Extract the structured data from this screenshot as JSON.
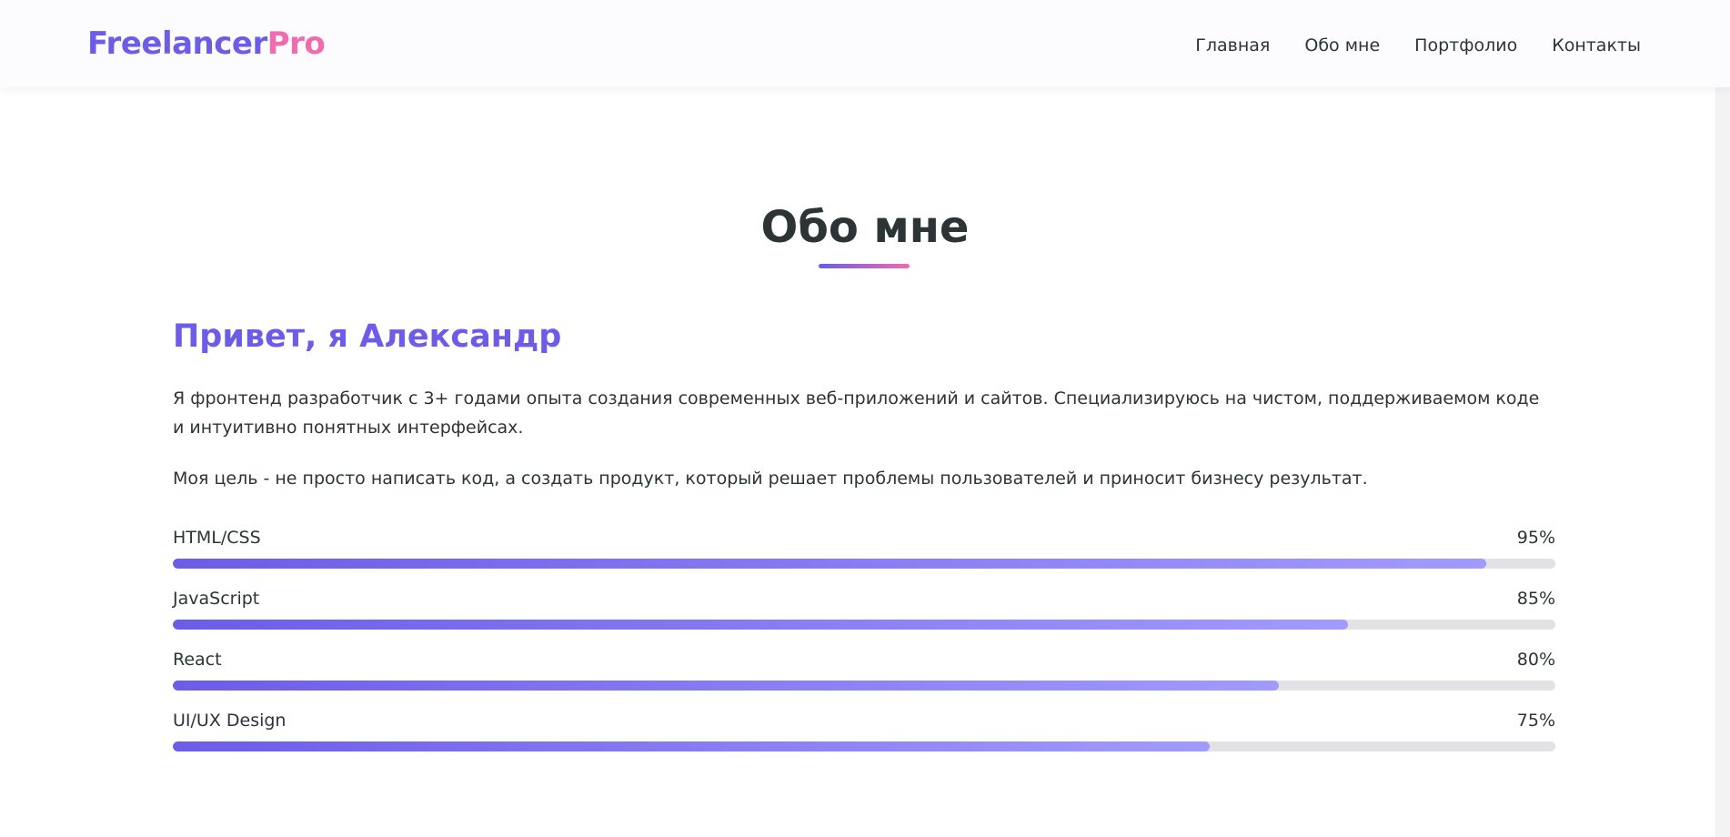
{
  "header": {
    "logo_part1": "Freelancer",
    "logo_part2": "Pro",
    "nav": [
      {
        "label": "Главная"
      },
      {
        "label": "Обо мне"
      },
      {
        "label": "Портфолио"
      },
      {
        "label": "Контакты"
      }
    ]
  },
  "about": {
    "title": "Обо мне",
    "greeting": "Привет, я Александр",
    "paragraphs": [
      "Я фронтенд разработчик с 3+ годами опыта создания современных веб-приложений и сайтов. Специализируюсь на чистом, поддерживаемом коде и интуитивно понятных интерфейсах.",
      "Моя цель - не просто написать код, а создать продукт, который решает проблемы пользователей и приносит бизнесу результат."
    ],
    "skills": [
      {
        "name": "HTML/CSS",
        "percent_label": "95%",
        "percent": 95
      },
      {
        "name": "JavaScript",
        "percent_label": "85%",
        "percent": 85
      },
      {
        "name": "React",
        "percent_label": "80%",
        "percent": 80
      },
      {
        "name": "UI/UX Design",
        "percent_label": "75%",
        "percent": 75
      }
    ]
  },
  "colors": {
    "accent": "#6c5ce7",
    "accent_pink": "#f06bb0",
    "accent_light": "#a29bfe",
    "text": "#2d3436",
    "track": "#e2e2e4"
  }
}
